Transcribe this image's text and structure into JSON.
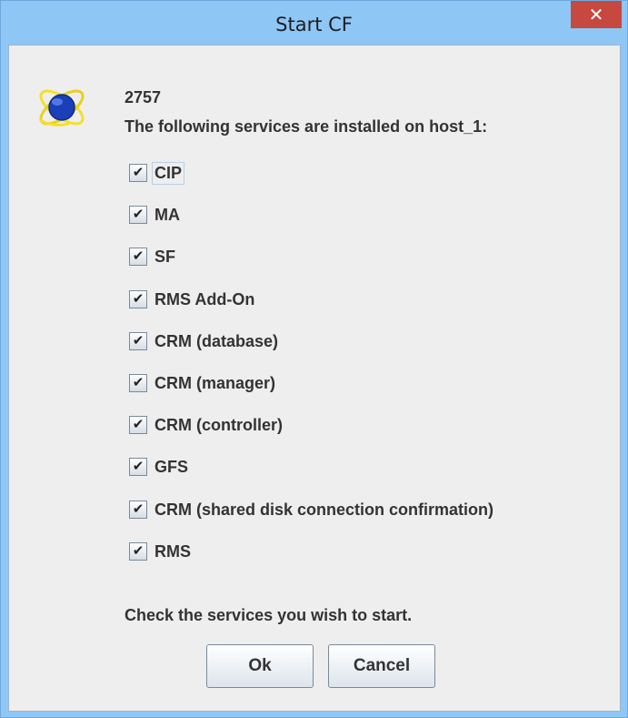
{
  "window": {
    "title": "Start CF",
    "close_glyph": "✕"
  },
  "icon": {
    "name": "cf-globe-icon"
  },
  "message": {
    "id": "2757",
    "text": "The following services are installed on host_1:"
  },
  "services": [
    {
      "label": "CIP",
      "checked": true,
      "focused": true
    },
    {
      "label": "MA",
      "checked": true
    },
    {
      "label": "SF",
      "checked": true
    },
    {
      "label": "RMS Add-On",
      "checked": true
    },
    {
      "label": "CRM (database)",
      "checked": true
    },
    {
      "label": "CRM (manager)",
      "checked": true
    },
    {
      "label": "CRM (controller)",
      "checked": true
    },
    {
      "label": "GFS",
      "checked": true
    },
    {
      "label": "CRM (shared disk connection confirmation)",
      "checked": true
    },
    {
      "label": "RMS",
      "checked": true
    }
  ],
  "check_glyph": "✔",
  "footer": {
    "text": "Check the services you wish to start."
  },
  "buttons": {
    "ok_label": "Ok",
    "cancel_label": "Cancel"
  },
  "colors": {
    "titlebar": "#8ec6f5",
    "close_button": "#c7483f",
    "dialog_background": "#eeeeee"
  }
}
